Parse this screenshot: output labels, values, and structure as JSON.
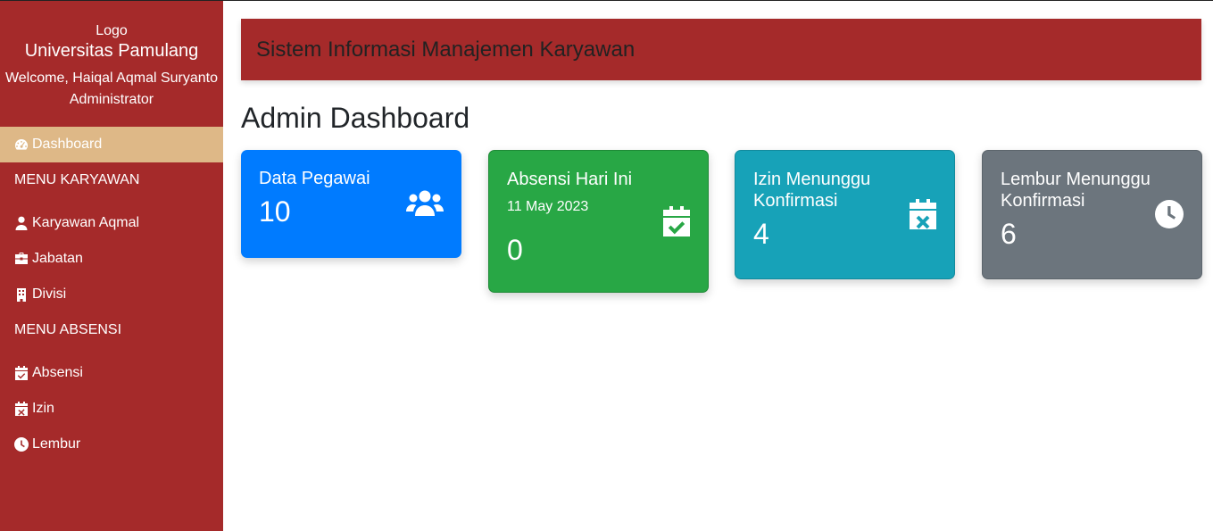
{
  "sidebar": {
    "logo_text": "Logo",
    "university": "Universitas Pamulang",
    "welcome": "Welcome, Haiqal Aqmal Suryanto",
    "role": "Administrator",
    "items": [
      {
        "label": "Dashboard",
        "icon": "dashboard-gauge-icon",
        "active": true
      },
      {
        "label": "MENU KARYAWAN",
        "heading": true
      },
      {
        "label": "Karyawan Aqmal",
        "icon": "user-icon"
      },
      {
        "label": "Jabatan",
        "icon": "briefcase-icon"
      },
      {
        "label": "Divisi",
        "icon": "building-icon"
      },
      {
        "label": "MENU ABSENSI",
        "heading": true
      },
      {
        "label": "Absensi",
        "icon": "calendar-check-icon"
      },
      {
        "label": "Izin",
        "icon": "calendar-x-icon"
      },
      {
        "label": "Lembur",
        "icon": "clock-icon"
      }
    ],
    "colors": {
      "background": "#a52a2a",
      "active": "#deb887"
    }
  },
  "header": {
    "title": "Sistem Informasi Manajemen Karyawan",
    "color": "#a52a2a"
  },
  "main": {
    "page_title": "Admin Dashboard",
    "cards": [
      {
        "title": "Data Pegawai",
        "value": "10",
        "icon": "users-icon",
        "color": "#007bff"
      },
      {
        "title": "Absensi Hari Ini",
        "date": "11 May 2023",
        "value": "0",
        "icon": "calendar-check-icon",
        "color": "#28a745"
      },
      {
        "title": "Izin Menunggu Konfirmasi",
        "value": "4",
        "icon": "calendar-x-icon",
        "color": "#17a2b8"
      },
      {
        "title": "Lembur Menunggu Konfirmasi",
        "value": "6",
        "icon": "clock-icon",
        "color": "#6c757d"
      }
    ]
  }
}
